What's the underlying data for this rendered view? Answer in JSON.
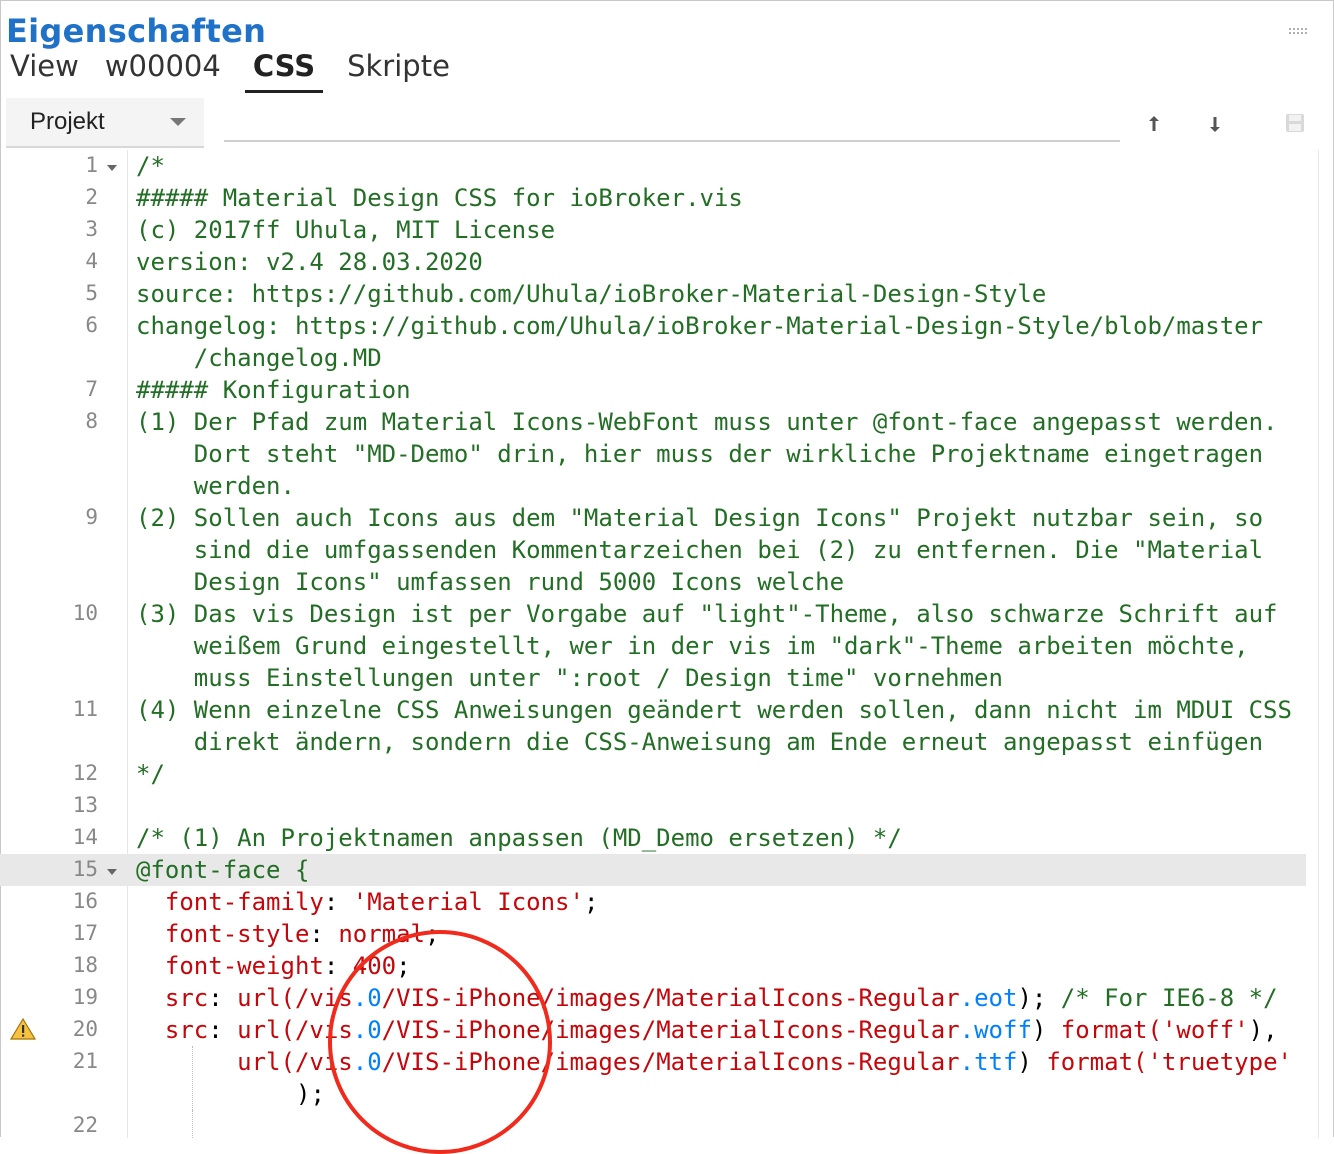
{
  "panel": {
    "title": "Eigenschaften"
  },
  "tabs": [
    {
      "label": "View",
      "active": false
    },
    {
      "label": "w00004",
      "active": false
    },
    {
      "label": "CSS",
      "active": true
    },
    {
      "label": "Skripte",
      "active": false
    }
  ],
  "scope_select": {
    "value": "Projekt"
  },
  "toolbar": {
    "upload_icon": "arrow-up-icon",
    "download_icon": "arrow-down-icon",
    "save_icon": "save-icon"
  },
  "editor": {
    "line_numbers": [
      "1",
      "2",
      "3",
      "4",
      "5",
      "6",
      "7",
      "8",
      "9",
      "10",
      "11",
      "12",
      "13",
      "14",
      "15",
      "16",
      "17",
      "18",
      "19",
      "20",
      "21",
      "22"
    ],
    "lines": {
      "l1": "/*",
      "l2": "##### Material Design CSS for ioBroker.vis",
      "l3": "(c) 2017ff Uhula, MIT License",
      "l4": "version: v2.4 28.03.2020",
      "l5": "source: https://github.com/Uhula/ioBroker-Material-Design-Style",
      "l6a": "changelog: https://github.com/Uhula/ioBroker-Material-Design-Style/blob/master",
      "l6b": "    /changelog.MD",
      "l7": "##### Konfiguration",
      "l8a": "(1) Der Pfad zum Material Icons-WebFont muss unter @font-face angepasst werden.",
      "l8b": "    Dort steht \"MD-Demo\" drin, hier muss der wirkliche Projektname eingetragen",
      "l8c": "    werden.",
      "l9a": "(2) Sollen auch Icons aus dem \"Material Design Icons\" Projekt nutzbar sein, so",
      "l9b": "    sind die umfgassenden Kommentarzeichen bei (2) zu entfernen. Die \"Material",
      "l9c": "    Design Icons\" umfassen rund 5000 Icons welche",
      "l10a": "(3) Das vis Design ist per Vorgabe auf \"light\"-Theme, also schwarze Schrift auf",
      "l10b": "    weißem Grund eingestellt, wer in der vis im \"dark\"-Theme arbeiten möchte,",
      "l10c": "    muss Einstellungen unter \":root / Design time\" vornehmen",
      "l11a": "(4) Wenn einzelne CSS Anweisungen geändert werden sollen, dann nicht im MDUI CSS",
      "l11b": "    direkt ändern, sondern die CSS-Anweisung am Ende erneut angepasst einfügen",
      "l12": "*/",
      "l14": "/* (1) An Projektnamen anpassen (MD_Demo ersetzen) */",
      "l15": "@font-face {",
      "l16_prop": "font-family",
      "l16_val": "'Material Icons'",
      "l17_prop": "font-style",
      "l17_val": "normal",
      "l18_prop": "font-weight",
      "l18_val": "400",
      "src_prop": "src",
      "url_fn": "url(",
      "path_a": "/vis",
      "path_dot": ".0",
      "path_b": "/VIS-iPhone/images/MaterialIcons-Regular",
      "ext_eot": ".eot",
      "ext_woff": ".woff",
      "ext_ttf": ".ttf",
      "comment_ie": "/* For IE6-8 */",
      "format_fn": "format(",
      "fmt_woff": "'woff'",
      "fmt_tt": "'truetype'",
      "l21b": ");"
    }
  },
  "colors": {
    "title": "#1f72c7",
    "comment": "#236e25",
    "property": "#c5060b",
    "number": "#0080ff",
    "annotation": "#f02a1c"
  }
}
